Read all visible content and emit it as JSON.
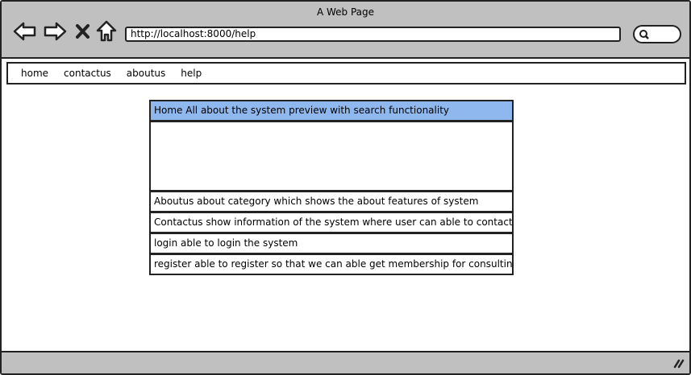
{
  "window": {
    "title": "A Web Page",
    "url": "http://localhost:8000/help"
  },
  "toolbar": {
    "icons": [
      "back-arrow-icon",
      "forward-arrow-icon",
      "close-x-icon",
      "home-icon",
      "search-icon"
    ]
  },
  "nav": {
    "items": [
      {
        "label": "home"
      },
      {
        "label": "contactus"
      },
      {
        "label": "aboutus"
      },
      {
        "label": "help"
      }
    ]
  },
  "help_list": {
    "header": "Home All about the system preview with search functionality",
    "items": [
      "Aboutus about category which shows the about features of system",
      "Contactus show information of the system where user can able to contact",
      "login able to login the system",
      "register able to register so that we can able get membership for consulting"
    ],
    "selected_color": "#8fb8ef"
  }
}
